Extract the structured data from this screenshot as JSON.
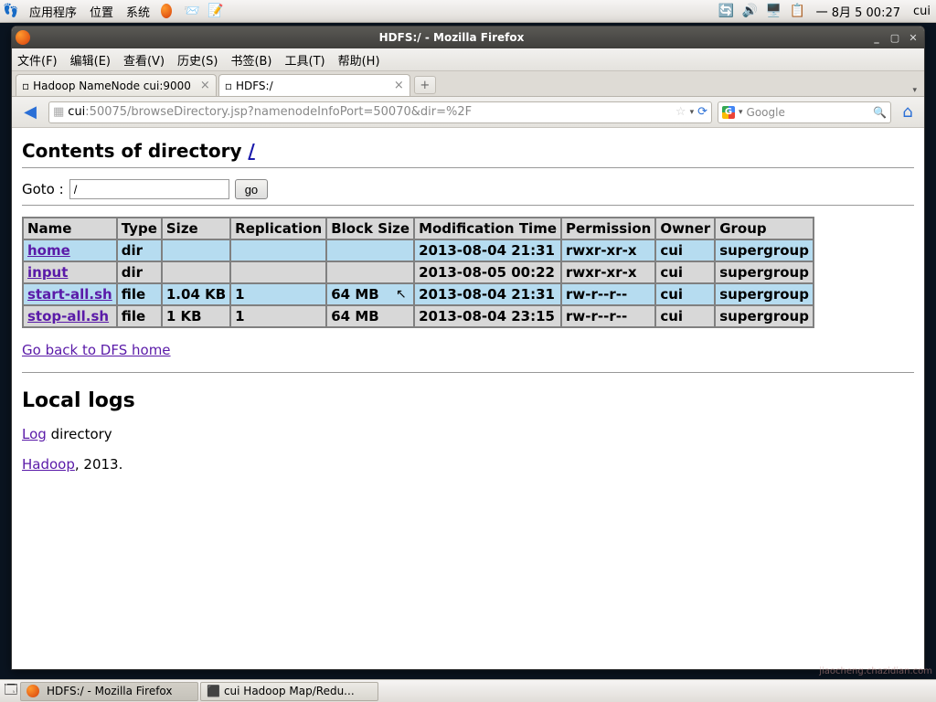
{
  "gnome": {
    "apps": "应用程序",
    "places": "位置",
    "system": "系统",
    "clock": "一 8月  5 00:27",
    "user": "cui"
  },
  "window": {
    "title": "HDFS:/ - Mozilla Firefox"
  },
  "menubar": {
    "file": "文件(F)",
    "edit": "编辑(E)",
    "view": "查看(V)",
    "history": "历史(S)",
    "bookmarks": "书签(B)",
    "tools": "工具(T)",
    "help": "帮助(H)"
  },
  "tabs": {
    "t0": "Hadoop NameNode cui:9000",
    "t1": "HDFS:/"
  },
  "url": {
    "host": "cui",
    "rest": ":50075/browseDirectory.jsp?namenodeInfoPort=50070&dir=%2F"
  },
  "search": {
    "placeholder": "Google"
  },
  "page": {
    "heading": "Contents of directory ",
    "heading_link": "/",
    "goto_label": "Goto : ",
    "goto_value": "/",
    "go_btn": "go",
    "cols": {
      "name": "Name",
      "type": "Type",
      "size": "Size",
      "repl": "Replication",
      "block": "Block Size",
      "mtime": "Modification Time",
      "perm": "Permission",
      "owner": "Owner",
      "group": "Group"
    },
    "rows": [
      {
        "name": "home",
        "type": "dir",
        "size": "",
        "repl": "",
        "block": "",
        "mtime": "2013-08-04 21:31",
        "perm": "rwxr-xr-x",
        "owner": "cui",
        "group": "supergroup"
      },
      {
        "name": "input",
        "type": "dir",
        "size": "",
        "repl": "",
        "block": "",
        "mtime": "2013-08-05 00:22",
        "perm": "rwxr-xr-x",
        "owner": "cui",
        "group": "supergroup"
      },
      {
        "name": "start-all.sh",
        "type": "file",
        "size": "1.04 KB",
        "repl": "1",
        "block": "64 MB",
        "mtime": "2013-08-04 21:31",
        "perm": "rw-r--r--",
        "owner": "cui",
        "group": "supergroup"
      },
      {
        "name": "stop-all.sh",
        "type": "file",
        "size": "1 KB",
        "repl": "1",
        "block": "64 MB",
        "mtime": "2013-08-04 23:15",
        "perm": "rw-r--r--",
        "owner": "cui",
        "group": "supergroup"
      }
    ],
    "back_link": "Go back to DFS home",
    "local_logs": "Local logs",
    "log_link": "Log",
    "log_suffix": " directory",
    "hadoop_link": "Hadoop",
    "hadoop_suffix": ", 2013."
  },
  "taskbar": {
    "t0": "HDFS:/ - Mozilla Firefox",
    "t1": "cui  Hadoop Map/Redu..."
  }
}
